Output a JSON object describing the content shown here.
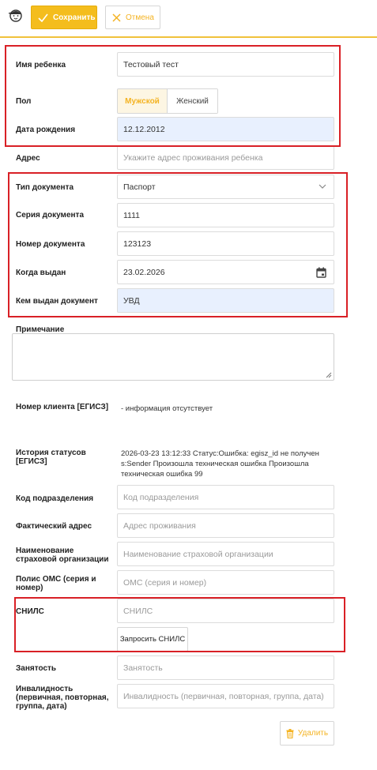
{
  "toolbar": {
    "logo_icon": "child-face-icon",
    "save_label": "Сохранить",
    "cancel_label": "Отмена",
    "accent_color": "#f4bd1d"
  },
  "form": {
    "child_name": {
      "label": "Имя ребенка",
      "value": "Тестовый тест"
    },
    "gender": {
      "label": "Пол",
      "options": [
        "Мужской",
        "Женский"
      ],
      "selected": "Мужской"
    },
    "birth_date": {
      "label": "Дата рождения",
      "value": "12.12.2012"
    },
    "address": {
      "label": "Адрес",
      "placeholder": "Укажите адрес проживания ребенка"
    },
    "doc_type": {
      "label": "Тип документа",
      "value": "Паспорт"
    },
    "doc_series": {
      "label": "Серия документа",
      "value": "1111"
    },
    "doc_number": {
      "label": "Номер документа",
      "value": "123123"
    },
    "issue_date": {
      "label": "Когда выдан",
      "value": "23.02.2026"
    },
    "issued_by": {
      "label": "Кем выдан документ",
      "value": "УВД"
    },
    "note": {
      "label": "Примечание",
      "value": ""
    },
    "client_number": {
      "label": "Номер клиента [ЕГИСЗ]",
      "value": "- информация отсутствует"
    },
    "status_history": {
      "label_line1": "История статусов",
      "label_line2": "[ЕГИСЗ]",
      "line1": "2026-03-23 13:12:33 Статус:Ошибка: egisz_id не получен",
      "line2": "s:Sender Произошла техническая ошибка Произошла",
      "line3": "техническая ошибка 99"
    },
    "division_code": {
      "label": "Код подразделения",
      "placeholder": "Код подразделения"
    },
    "actual_address": {
      "label": "Фактический адрес",
      "placeholder": "Адрес проживания"
    },
    "insurer_name": {
      "label_line1": "Наименование",
      "label_line2": "страховой организации",
      "placeholder": "Наименование страховой организации"
    },
    "oms_policy": {
      "label_line1": "Полис ОМС (серия и",
      "label_line2": "номер)",
      "placeholder": "ОМС (серия и номер)"
    },
    "snils": {
      "label": "СНИЛС",
      "placeholder": "СНИЛС",
      "request_button": "Запросить СНИЛС"
    },
    "employment": {
      "label": "Занятость",
      "placeholder": "Занятость"
    },
    "disability": {
      "label_line1": "Инвалидность",
      "label_line2": "(первичная, повторная,",
      "label_line3": "группа, дата)",
      "placeholder": "Инвалидность (первичная, повторная, группа, дата)"
    },
    "delete_label": "Удалить"
  },
  "highlight_color": "#d92026"
}
